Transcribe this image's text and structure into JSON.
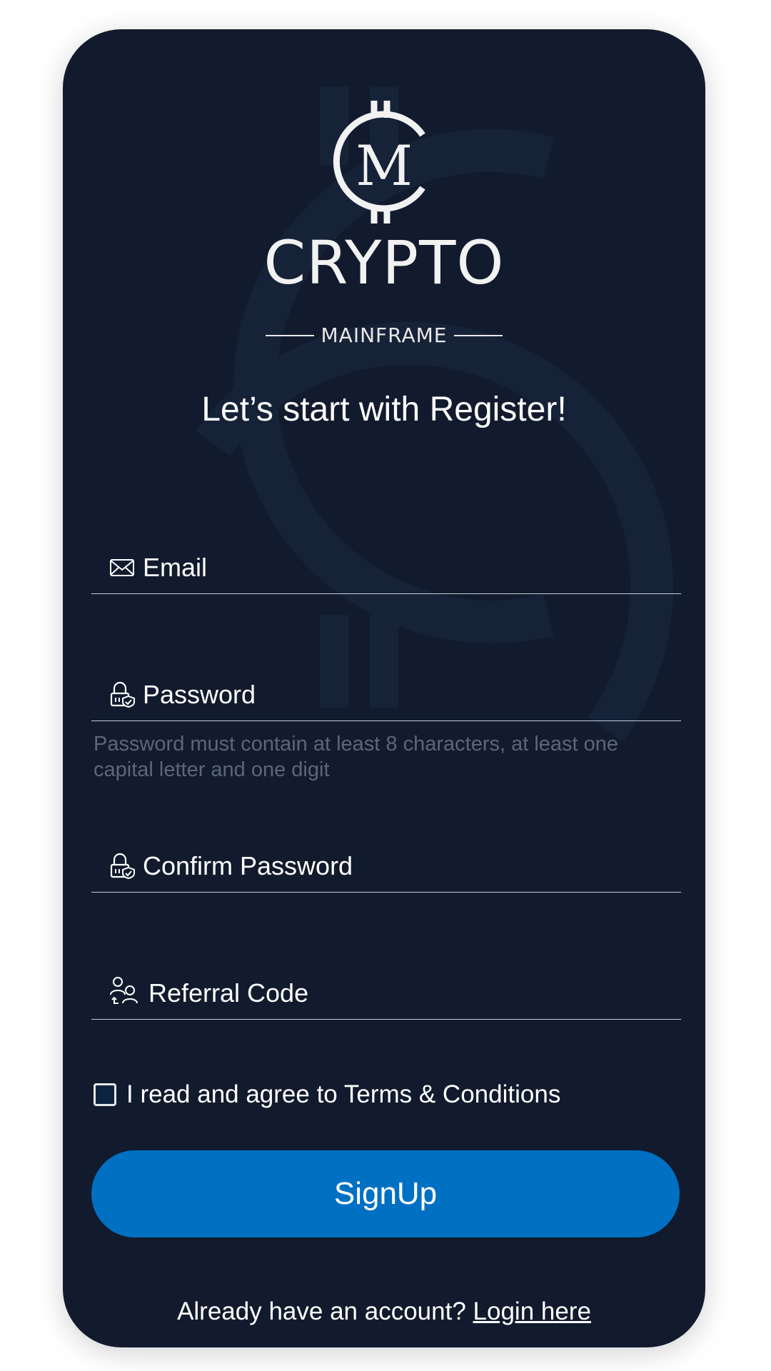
{
  "brand": {
    "title": "CRYPTO",
    "subtitle": "MAINFRAME",
    "logo_letter": "M"
  },
  "headline": "Let’s start with Register!",
  "fields": {
    "email": {
      "label": "Email",
      "icon": "envelope-icon"
    },
    "password": {
      "label": "Password",
      "icon": "lock-shield-icon",
      "hint": "Password must contain at least 8 characters, at least one capital letter and one digit"
    },
    "confirm_password": {
      "label": "Confirm Password",
      "icon": "lock-shield-icon"
    },
    "referral": {
      "label": "Referral Code",
      "icon": "referral-users-icon"
    }
  },
  "terms": {
    "label": "I read and agree to Terms & Conditions",
    "checked": false
  },
  "signup_button": "SignUp",
  "login": {
    "prompt": "Already have an account? ",
    "link": "Login here"
  },
  "colors": {
    "background": "#111b2d",
    "primary_button": "#0070c3",
    "text": "#ffffff",
    "hint": "#5d6676"
  }
}
